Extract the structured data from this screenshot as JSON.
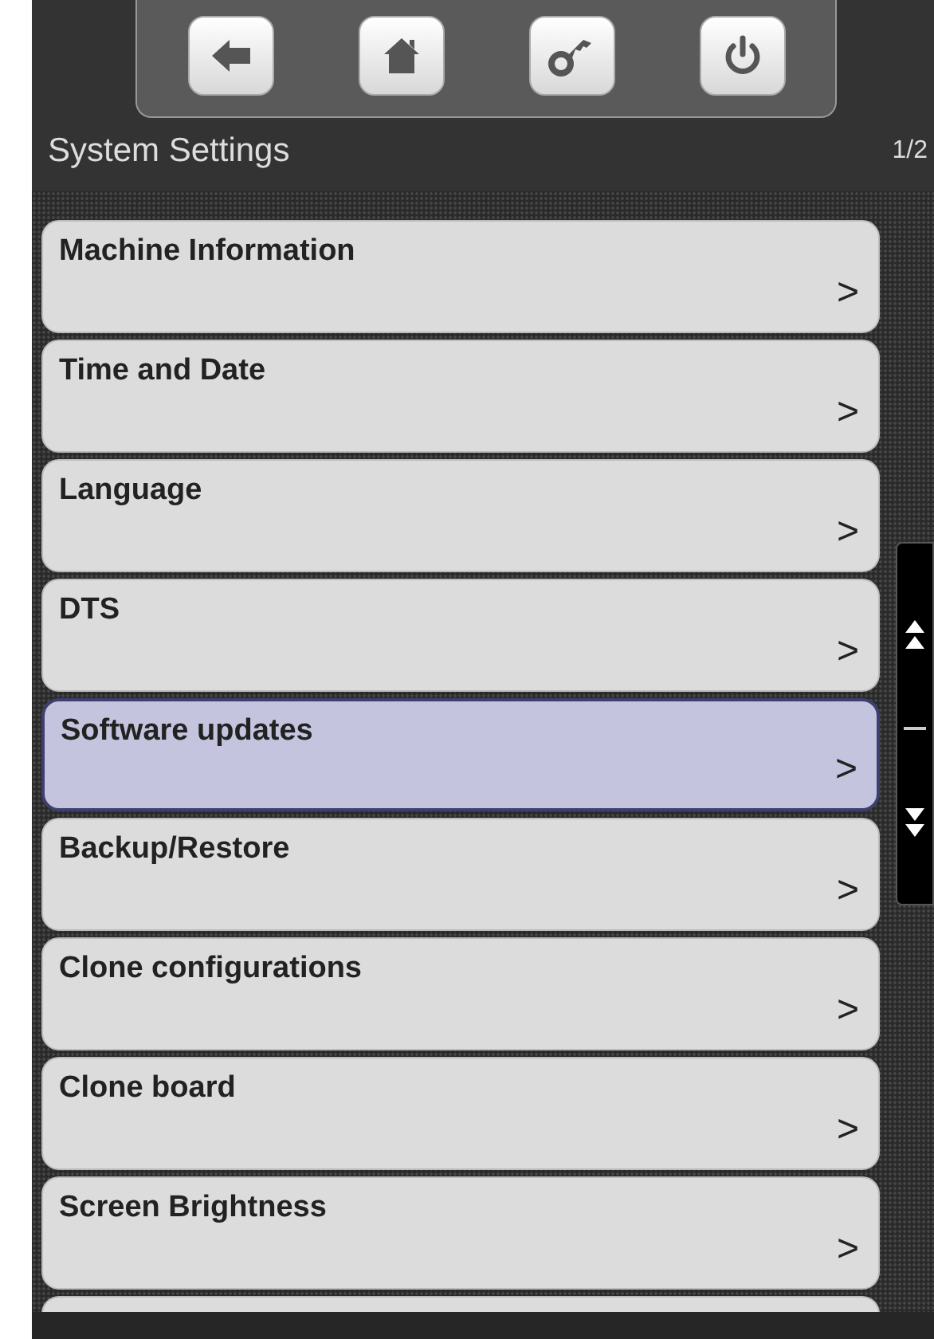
{
  "toolbar": {
    "buttons": [
      {
        "kind": "back"
      },
      {
        "kind": "home"
      },
      {
        "kind": "key"
      },
      {
        "kind": "power"
      }
    ]
  },
  "header": {
    "title": "System Settings",
    "page": "1/2"
  },
  "menu": {
    "items": [
      {
        "label": "Machine Information",
        "arrow": ">",
        "selected": false
      },
      {
        "label": "Time and Date",
        "arrow": ">",
        "selected": false
      },
      {
        "label": "Language",
        "arrow": ">",
        "selected": false
      },
      {
        "label": "DTS",
        "arrow": ">",
        "selected": false
      },
      {
        "label": "Software updates",
        "arrow": ">",
        "selected": true
      },
      {
        "label": "Backup/Restore",
        "arrow": ">",
        "selected": false
      },
      {
        "label": "Clone configurations",
        "arrow": ">",
        "selected": false
      },
      {
        "label": "Clone board",
        "arrow": ">",
        "selected": false
      },
      {
        "label": "Screen Brightness",
        "arrow": ">",
        "selected": false
      }
    ],
    "partial_item": true
  }
}
